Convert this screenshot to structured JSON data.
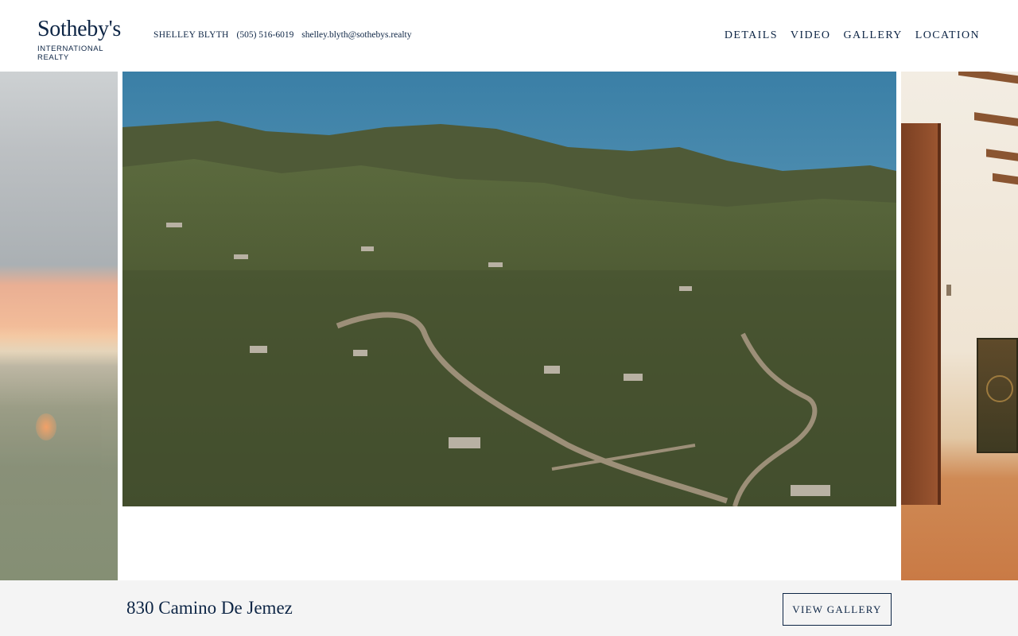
{
  "brand": {
    "name": "Sotheby's",
    "subtitle": "INTERNATIONAL REALTY"
  },
  "agent": {
    "name": "SHELLEY BLYTH",
    "phone": "(505) 516-6019",
    "email": "shelley.blyth@sothebys.realty"
  },
  "nav": {
    "items": [
      {
        "label": "DETAILS"
      },
      {
        "label": "VIDEO"
      },
      {
        "label": "GALLERY"
      },
      {
        "label": "LOCATION"
      }
    ]
  },
  "listing": {
    "address": "830 Camino De Jemez",
    "view_gallery_label": "VIEW GALLERY"
  },
  "colors": {
    "brand_navy": "#0d2545",
    "footer_bg": "#f4f4f4"
  }
}
